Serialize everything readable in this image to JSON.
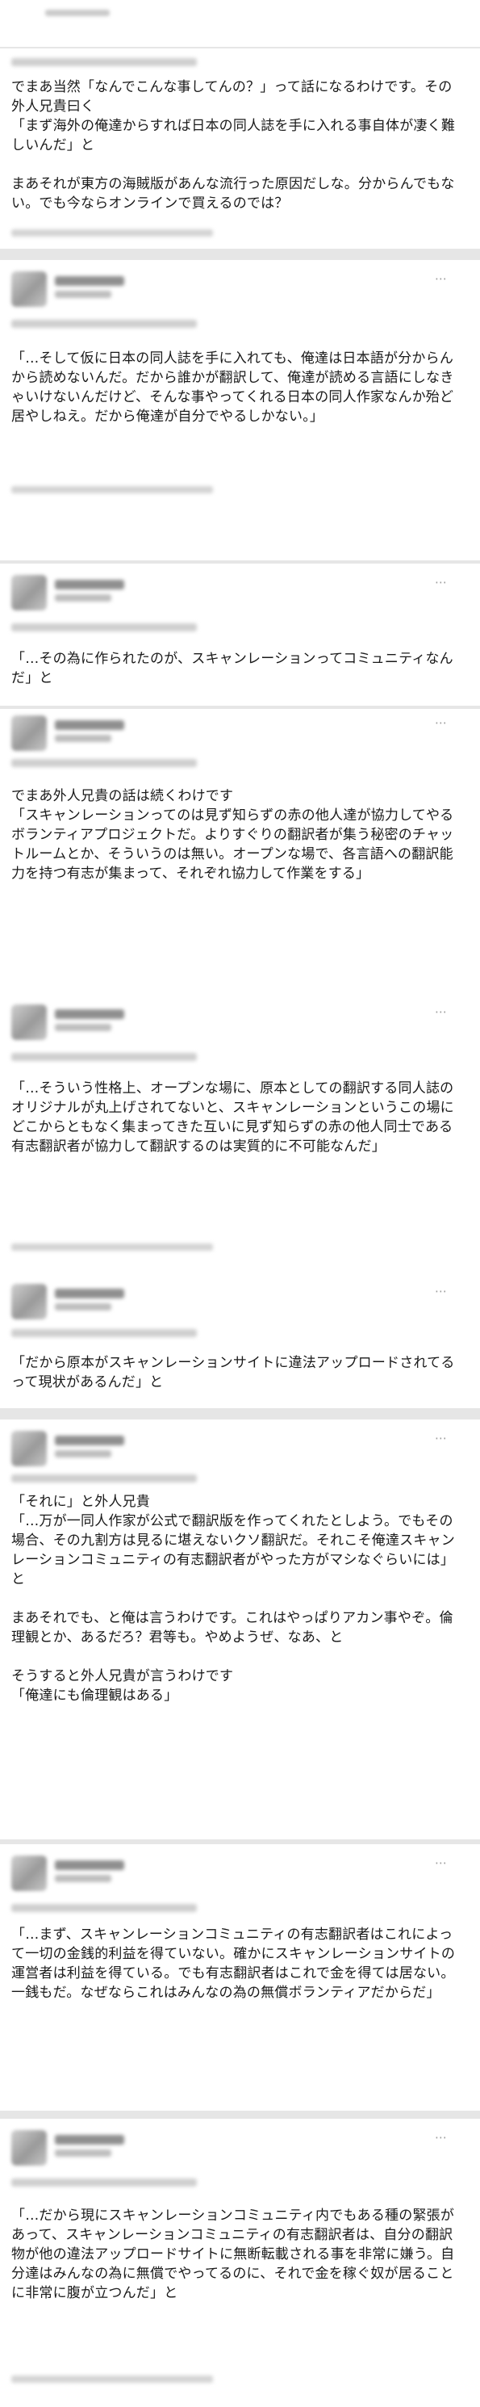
{
  "tweets": [
    {
      "text": "でまあ当然「なんでこんな事してんの？」って話になるわけです。その外人兄貴曰く\n「まず海外の俺達からすれば日本の同人誌を手に入れる事自体が凄く難しいんだ」と\n\nまあそれが東方の海賊版があんな流行った原因だしな。分からんでもない。でも今ならオンラインで買えるのでは？"
    },
    {
      "text": "「…そして仮に日本の同人誌を手に入れても、俺達は日本語が分からんから読めないんだ。だから誰かが翻訳して、俺達が読める言語にしなきゃいけないんだけど、そんな事やってくれる日本の同人作家なんか殆ど居やしねえ。だから俺達が自分でやるしかない。」"
    },
    {
      "text": "「…その為に作られたのが、スキャンレーションってコミュニティなんだ」と"
    },
    {
      "text": "でまあ外人兄貴の話は続くわけです\n「スキャンレーションってのは見ず知らずの赤の他人達が協力してやるボランティアプロジェクトだ。よりすぐりの翻訳者が集う秘密のチャットルームとか、そういうのは無い。オープンな場で、各言語への翻訳能力を持つ有志が集まって、それぞれ協力して作業をする」"
    },
    {
      "text": "「…そういう性格上、オープンな場に、原本としての翻訳する同人誌のオリジナルが丸上げされてないと、スキャンレーションというこの場にどこからともなく集まってきた互いに見ず知らずの赤の他人同士である有志翻訳者が協力して翻訳するのは実質的に不可能なんだ」"
    },
    {
      "text": "「だから原本がスキャンレーションサイトに違法アップロードされてるって現状があるんだ」と"
    },
    {
      "text": "「それに」と外人兄貴\n「…万が一同人作家が公式で翻訳版を作ってくれたとしよう。でもその場合、その九割方は見るに堪えないクソ翻訳だ。それこそ俺達スキャンレーションコミュニティの有志翻訳者がやった方がマシなぐらいには」と\n\nまあそれでも、と俺は言うわけです。これはやっぱりアカン事やぞ。倫理観とか、あるだろ？君等も。やめようぜ、なあ、と\n\nそうすると外人兄貴が言うわけです\n「俺達にも倫理観はある」"
    },
    {
      "text": "「…まず、スキャンレーションコミュニティの有志翻訳者はこれによって一切の金銭的利益を得ていない。確かにスキャンレーションサイトの運営者は利益を得ている。でも有志翻訳者はこれで金を得ては居ない。一銭もだ。なぜならこれはみんなの為の無償ボランティアだからだ」"
    },
    {
      "text": "「…だから現にスキャンレーションコミュニティ内でもある種の緊張があって、スキャンレーションコミュニティの有志翻訳者は、自分の翻訳物が他の違法アップロードサイトに無断転載される事を非常に嫌う。自分達はみんなの為に無償でやってるのに、それで金を稼ぐ奴が居ることに非常に腹が立つんだ」と"
    }
  ]
}
